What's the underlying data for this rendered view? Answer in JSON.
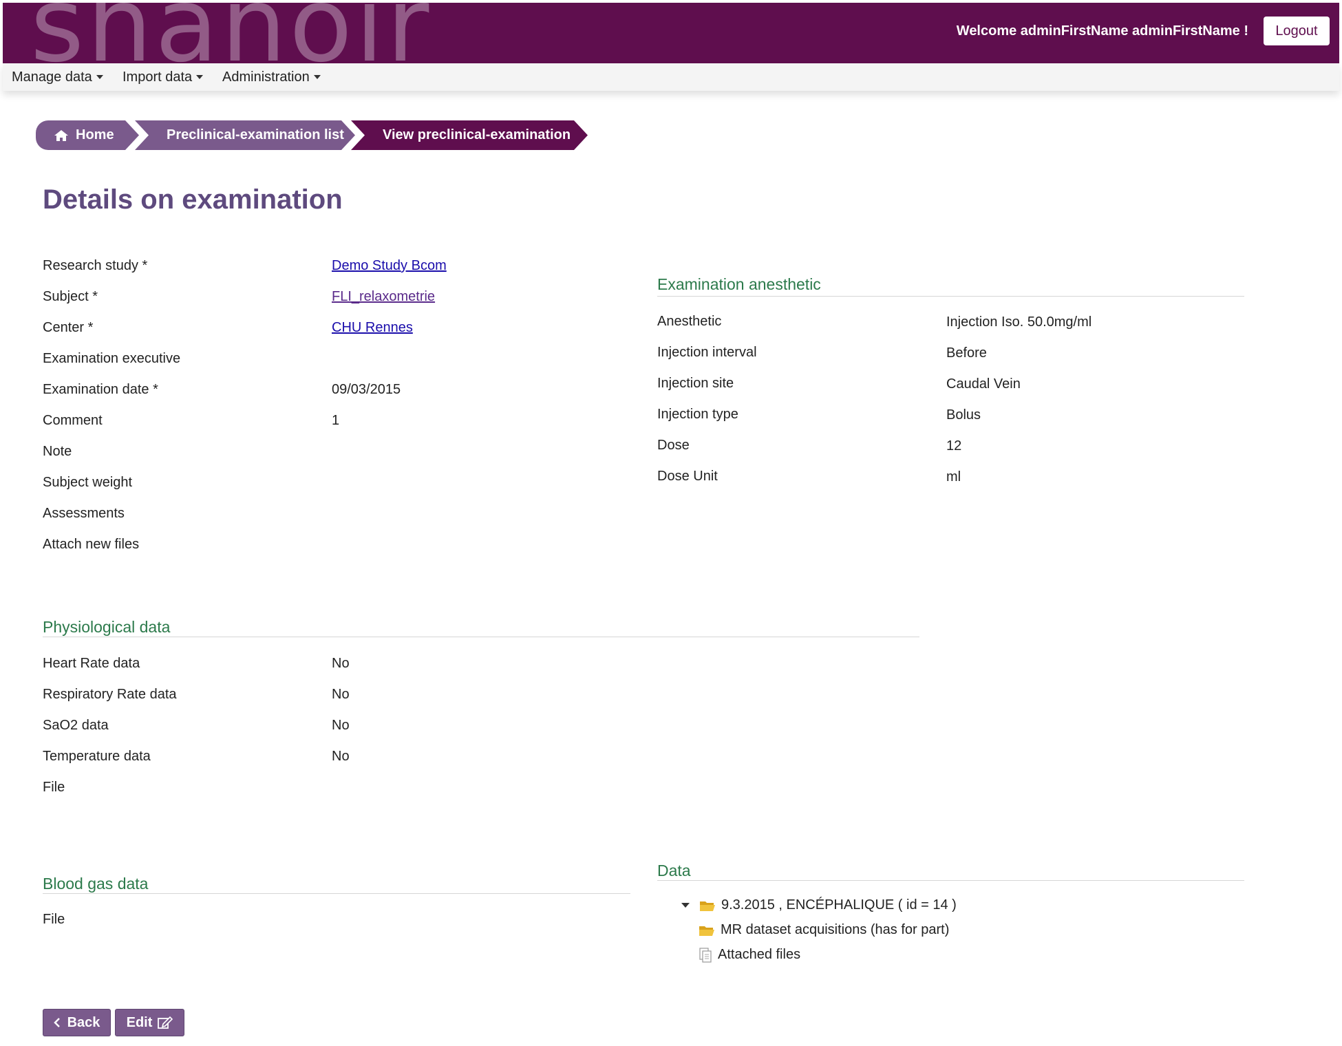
{
  "header": {
    "logo_text": "shanoir",
    "welcome": "Welcome adminFirstName adminFirstName !",
    "logout_label": "Logout",
    "brand_color": "#5f0e4e"
  },
  "menu": {
    "items": [
      {
        "label": "Manage data"
      },
      {
        "label": "Import data"
      },
      {
        "label": "Administration"
      }
    ]
  },
  "breadcrumb": {
    "home": "Home",
    "list": "Preclinical-examination list",
    "current": "View preclinical-examination"
  },
  "page_title": "Details on examination",
  "details": {
    "research_study": {
      "label": "Research study *",
      "value": "Demo Study Bcom"
    },
    "subject": {
      "label": "Subject *",
      "value": "FLI_relaxometrie"
    },
    "center": {
      "label": "Center *",
      "value": "CHU Rennes"
    },
    "examination_executive": {
      "label": "Examination executive",
      "value": ""
    },
    "examination_date": {
      "label": "Examination date *",
      "value": "09/03/2015"
    },
    "comment": {
      "label": "Comment",
      "value": "1"
    },
    "note": {
      "label": "Note",
      "value": ""
    },
    "subject_weight": {
      "label": "Subject weight",
      "value": ""
    },
    "assessments": {
      "label": "Assessments",
      "value": ""
    },
    "attach_new_files": {
      "label": "Attach new files",
      "value": ""
    }
  },
  "anesthetic": {
    "title": "Examination anesthetic",
    "rows": [
      {
        "label": "Anesthetic",
        "value": "Injection Iso. 50.0mg/ml"
      },
      {
        "label": "Injection interval",
        "value": "Before"
      },
      {
        "label": "Injection site",
        "value": "Caudal Vein"
      },
      {
        "label": "Injection type",
        "value": "Bolus"
      },
      {
        "label": "Dose",
        "value": "12"
      },
      {
        "label": "Dose Unit",
        "value": "ml"
      }
    ]
  },
  "physiological": {
    "title": "Physiological data",
    "rows": [
      {
        "label": "Heart Rate data",
        "value": "No"
      },
      {
        "label": "Respiratory Rate data",
        "value": "No"
      },
      {
        "label": "SaO2 data",
        "value": "No"
      },
      {
        "label": "Temperature data",
        "value": "No"
      },
      {
        "label": "File",
        "value": ""
      }
    ]
  },
  "blood_gas": {
    "title": "Blood gas data",
    "file_label": "File"
  },
  "data_tree": {
    "title": "Data",
    "root": "9.3.2015 , ENCÉPHALIQUE ( id = 14 )",
    "child_acquisitions": "MR dataset acquisitions (has for part)",
    "child_files": "Attached files"
  },
  "buttons": {
    "back": "Back",
    "edit": "Edit"
  }
}
